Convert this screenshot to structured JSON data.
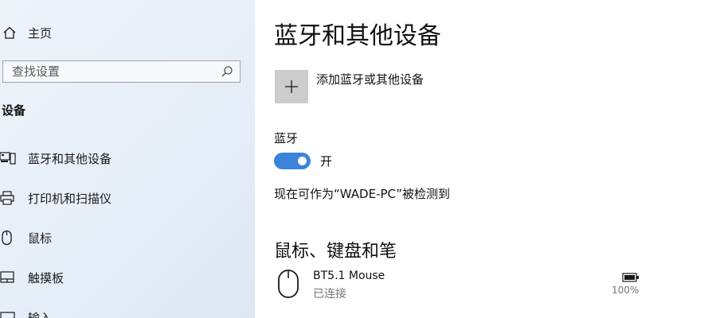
{
  "sidebar": {
    "home": {
      "label": "主页",
      "icon": "home-icon"
    },
    "search": {
      "placeholder": "查找设置",
      "icon": "search-icon"
    },
    "section_title": "设备",
    "items": [
      {
        "label": "蓝牙和其他设备",
        "icon": "bluetooth-devices-icon"
      },
      {
        "label": "打印机和扫描仪",
        "icon": "printer-icon"
      },
      {
        "label": "鼠标",
        "icon": "mouse-icon"
      },
      {
        "label": "触摸板",
        "icon": "touchpad-icon"
      },
      {
        "label": "输入",
        "icon": "keyboard-icon"
      }
    ]
  },
  "main": {
    "title": "蓝牙和其他设备",
    "add_device": {
      "label": "添加蓝牙或其他设备",
      "icon": "plus-icon"
    },
    "bluetooth": {
      "label": "蓝牙",
      "state": "开",
      "on": true
    },
    "discoverable": "现在可作为“WADE-PC”被检测到",
    "section": "鼠标、键盘和笔",
    "devices": [
      {
        "name": "BT5.1 Mouse",
        "status": "已连接",
        "battery": "100%",
        "icon": "mouse-icon"
      }
    ]
  },
  "colors": {
    "accent": "#3b84db",
    "sidebar_bg": "#e8eff8",
    "tile_bg": "#cccccc",
    "muted": "#767676"
  }
}
